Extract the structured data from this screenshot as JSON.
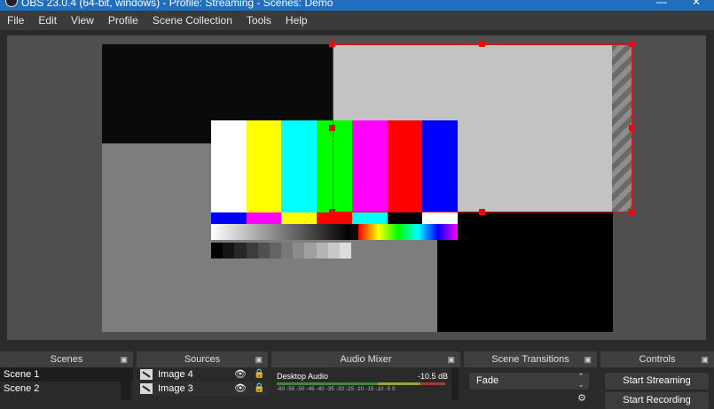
{
  "window": {
    "title": "OBS 23.0.4 (64-bit, windows) - Profile: Streaming - Scenes: Demo",
    "minimize_glyph": "—",
    "close_glyph": "✕",
    "icon": "obs-logo-icon"
  },
  "menu": [
    "File",
    "Edit",
    "View",
    "Profile",
    "Scene Collection",
    "Tools",
    "Help"
  ],
  "preview": {
    "color_bars": [
      "#ffffff",
      "#ffff00",
      "#00ffff",
      "#00ff00",
      "#ff00ff",
      "#ff0000",
      "#0000ff"
    ],
    "reverse_bars": [
      "#0000ff",
      "#ff00ff",
      "#ffff00",
      "#ff0000",
      "#00ffff",
      "#000000",
      "#ffffff"
    ],
    "gray_steps": [
      "#000000",
      "#141414",
      "#282828",
      "#3c3c3c",
      "#505050",
      "#646464",
      "#787878",
      "#8c8c8c",
      "#a0a0a0",
      "#b4b4b4",
      "#c8c8c8",
      "#dcdcdc"
    ],
    "selection_color": "#e01010"
  },
  "docks": {
    "scenes": {
      "title": "Scenes",
      "items": [
        "Scene 1",
        "Scene 2"
      ]
    },
    "sources": {
      "title": "Sources",
      "items": [
        "Image 4",
        "Image 3"
      ]
    },
    "mixer": {
      "title": "Audio Mixer",
      "channel": "Desktop Audio",
      "level": "-10.5 dB",
      "ticks": "-60 -55 -50 -45 -40 -35 -30 -25 -20 -15 -10 -5 0"
    },
    "transitions": {
      "title": "Scene Transitions",
      "selected": "Fade"
    },
    "controls": {
      "title": "Controls",
      "buttons": [
        "Start Streaming",
        "Start Recording"
      ]
    }
  },
  "icons": {
    "pin": "dock-float-icon",
    "eye": "visibility-eye-icon",
    "lock": "lock-icon",
    "gear": "gear-icon"
  }
}
